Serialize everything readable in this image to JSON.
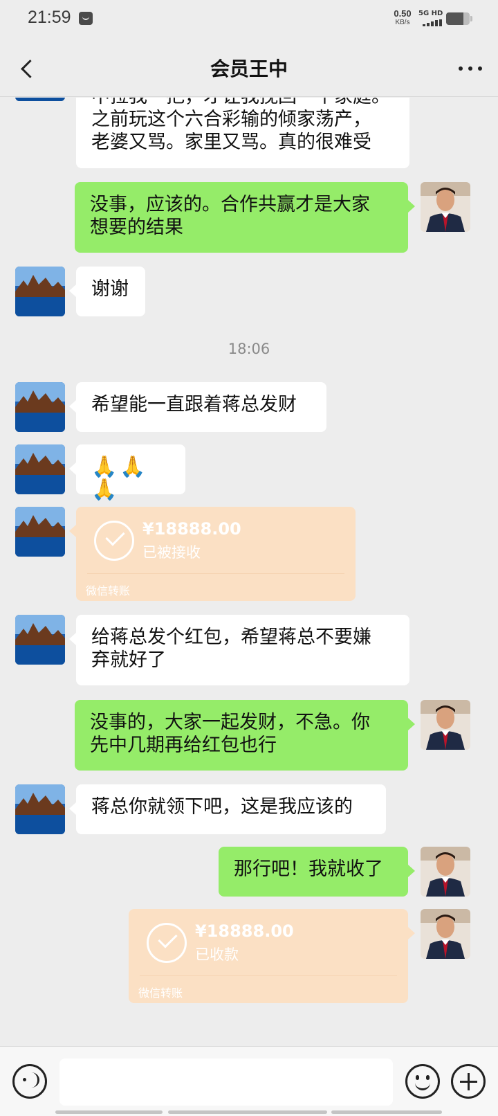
{
  "status_bar": {
    "time": "21:59",
    "net_speed": "0.50",
    "net_speed_unit": "KB/s",
    "network_type": "5G HD",
    "notification_icon": "message-icon",
    "signal_icon": "signal-icon",
    "battery_icon": "battery-icon"
  },
  "nav": {
    "title": "会员王中",
    "back_icon": "chevron-left-icon",
    "more_icon": "more-dots-icon"
  },
  "messages": [
    {
      "side": "in",
      "type": "text",
      "lines": [
        "中拉我一把，才让我挽回一个家庭。",
        "之前玩这个六合彩输的倾家荡产，",
        "老婆又骂。家里又骂。真的很难受"
      ]
    },
    {
      "side": "out",
      "type": "text",
      "lines": [
        "没事，应该的。合作共赢才是大家",
        "想要的结果"
      ]
    },
    {
      "side": "in",
      "type": "text",
      "lines": [
        "谢谢"
      ]
    },
    {
      "type": "timestamp",
      "text": "18:06"
    },
    {
      "side": "in",
      "type": "text",
      "lines": [
        "希望能一直跟着蒋总发财"
      ]
    },
    {
      "side": "in",
      "type": "emoji",
      "text": "🙏🙏🙏"
    },
    {
      "side": "in",
      "type": "transfer",
      "amount": "¥18888.00",
      "status": "已被接收",
      "label": "微信转账"
    },
    {
      "side": "in",
      "type": "text",
      "lines": [
        "给蒋总发个红包，希望蒋总不要嫌",
        "弃就好了"
      ]
    },
    {
      "side": "out",
      "type": "text",
      "lines": [
        "没事的，大家一起发财，不急。你",
        "先中几期再给红包也行"
      ]
    },
    {
      "side": "in",
      "type": "text",
      "lines": [
        "蒋总你就领下吧，这是我应该的"
      ]
    },
    {
      "side": "out",
      "type": "text",
      "lines": [
        "那行吧！我就收了"
      ]
    },
    {
      "side": "out",
      "type": "transfer",
      "amount": "¥18888.00",
      "status": "已收款",
      "label": "微信转账"
    }
  ],
  "input_bar": {
    "voice_icon": "voice-icon",
    "input_placeholder": "",
    "emoji_icon": "emoji-icon",
    "plus_icon": "plus-icon"
  },
  "colors": {
    "background": "#ededed",
    "incoming_bubble": "#ffffff",
    "outgoing_bubble": "#95ec69",
    "transfer_card": "#fbe0c4"
  }
}
